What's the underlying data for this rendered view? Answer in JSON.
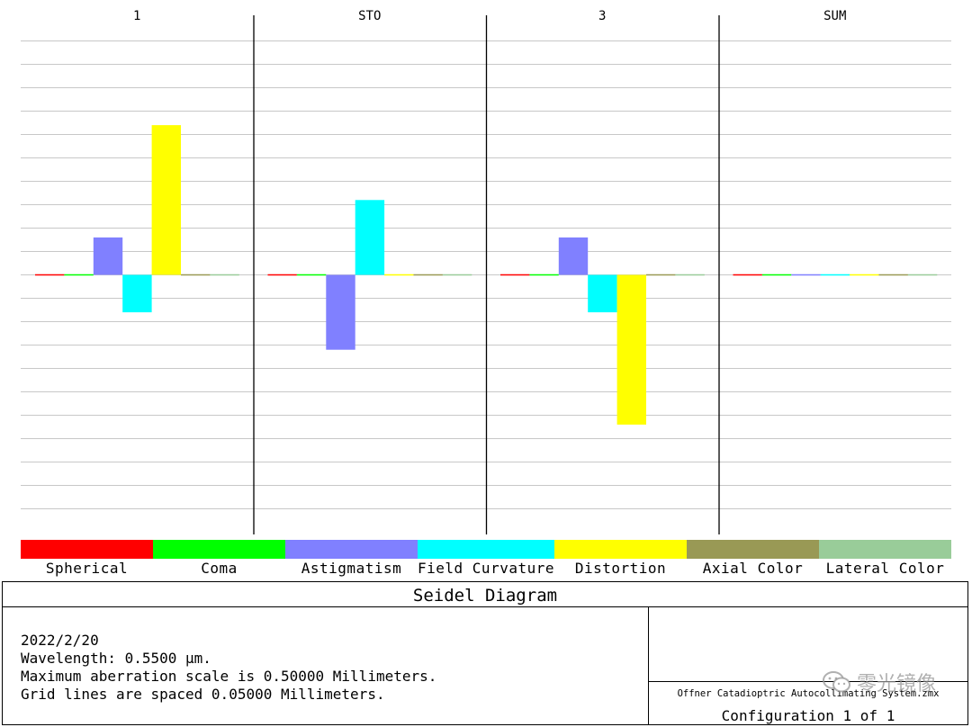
{
  "chart_data": {
    "type": "bar",
    "title": "Seidel Diagram",
    "categories": [
      "1",
      "STO",
      "3",
      "SUM"
    ],
    "series": [
      {
        "name": "Spherical",
        "color": "#ff0000",
        "values": [
          0,
          0,
          0,
          0
        ]
      },
      {
        "name": "Coma",
        "color": "#00ff00",
        "values": [
          0,
          0,
          0,
          0
        ]
      },
      {
        "name": "Astigmatism",
        "color": "#8080ff",
        "values": [
          0.08,
          -0.16,
          0.08,
          0
        ]
      },
      {
        "name": "Field Curvature",
        "color": "#00ffff",
        "values": [
          -0.08,
          0.16,
          -0.08,
          0
        ]
      },
      {
        "name": "Distortion",
        "color": "#ffff00",
        "values": [
          0.32,
          0,
          -0.32,
          0
        ]
      },
      {
        "name": "Axial Color",
        "color": "#999955",
        "values": [
          0,
          0,
          0,
          0
        ]
      },
      {
        "name": "Lateral Color",
        "color": "#99cc99",
        "values": [
          0,
          0,
          0,
          0
        ]
      }
    ],
    "ylim": [
      -0.5,
      0.5
    ],
    "grid_spacing": 0.05,
    "grid": true,
    "legend_placement": "bottom"
  },
  "info": {
    "date": "2022/2/20",
    "wavelength": "Wavelength: 0.5500 µm.",
    "max_scale": "Maximum aberration scale is 0.50000 Millimeters.",
    "grid_spacing": "Grid lines are spaced 0.05000 Millimeters."
  },
  "file_name": "Offner Catadioptric Autocollimating System.zmx",
  "configuration": "Configuration 1 of 1",
  "watermark": "零光镜像"
}
